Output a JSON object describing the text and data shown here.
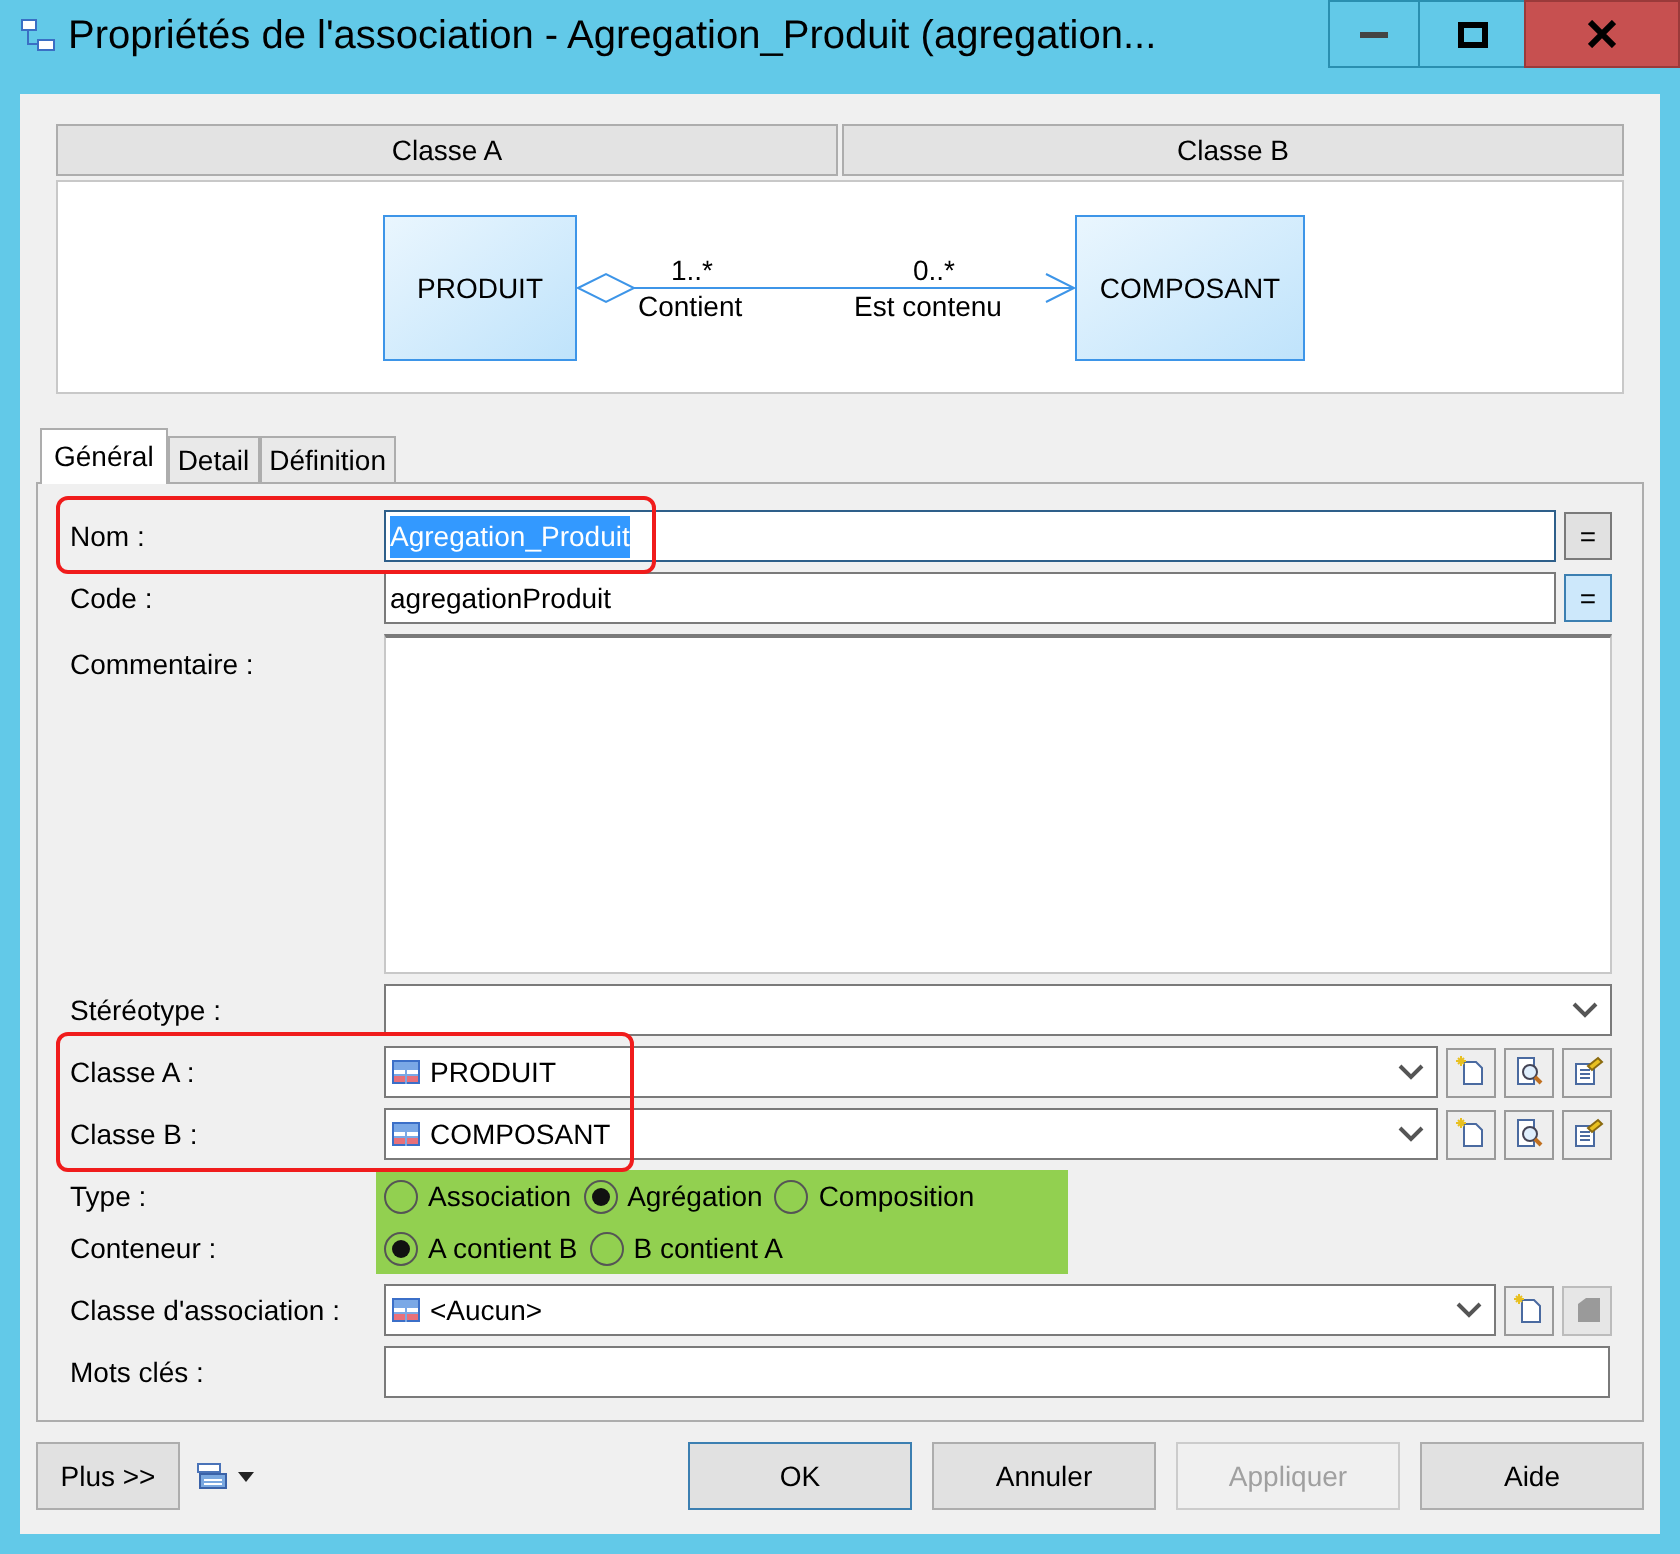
{
  "window": {
    "title": "Propriétés de l'association - Agregation_Produit (agregation..."
  },
  "diagram": {
    "headers": [
      "Classe A",
      "Classe B"
    ],
    "class_a": "PRODUIT",
    "class_b": "COMPOSANT",
    "role_a": {
      "multiplicity": "1..*",
      "name": "Contient"
    },
    "role_b": {
      "multiplicity": "0..*",
      "name": "Est contenu"
    }
  },
  "tabs": [
    {
      "label": "Général",
      "selected": true
    },
    {
      "label": "Detail",
      "selected": false
    },
    {
      "label": "Définition",
      "selected": false
    }
  ],
  "fields": [
    {
      "kind": "text",
      "label": "Nom :",
      "value": "Agregation_Produit",
      "text_selected": true,
      "red_frame": true,
      "equals": {
        "label": "=",
        "on": false
      }
    },
    {
      "kind": "text",
      "label": "Code :",
      "value": "agregationProduit",
      "text_selected": false,
      "equals": {
        "label": "=",
        "on": true
      }
    },
    {
      "kind": "textarea",
      "label": "Commentaire :"
    },
    {
      "kind": "combo",
      "label": "Stéréotype :"
    },
    {
      "kind": "class-combo",
      "label": "Classe A :",
      "value": "PRODUIT",
      "red_frame": true,
      "buttons": [
        {
          "kind": "new",
          "disabled": false
        },
        {
          "kind": "find",
          "disabled": false
        },
        {
          "kind": "properties",
          "disabled": false
        }
      ]
    },
    {
      "kind": "class-combo",
      "label": "Classe B :",
      "value": "COMPOSANT",
      "red_frame": true,
      "buttons": [
        {
          "kind": "new",
          "disabled": false
        },
        {
          "kind": "find",
          "disabled": false
        },
        {
          "kind": "properties",
          "disabled": false
        }
      ]
    },
    {
      "kind": "radio",
      "label": "Type :",
      "green_fill": true,
      "options": [
        {
          "label": "Association",
          "selected": false
        },
        {
          "label": "Agrégation",
          "selected": true
        },
        {
          "label": "Composition",
          "selected": false
        }
      ]
    },
    {
      "kind": "radio",
      "label": "Conteneur :",
      "green_fill": true,
      "options": [
        {
          "label": "A contient B",
          "selected": true
        },
        {
          "label": "B contient A",
          "selected": false
        }
      ]
    },
    {
      "kind": "class-combo",
      "label": "Classe d'association :",
      "value": "<Aucun>",
      "buttons": [
        {
          "kind": "new",
          "disabled": false
        },
        {
          "kind": "properties",
          "disabled": true
        }
      ]
    },
    {
      "kind": "text",
      "label": "Mots clés :"
    }
  ],
  "footer": {
    "more": "Plus >>",
    "actions": [
      {
        "label": "OK",
        "default": true,
        "disabled": false
      },
      {
        "label": "Annuler",
        "default": false,
        "disabled": false
      },
      {
        "label": "Appliquer",
        "default": false,
        "disabled": true
      },
      {
        "label": "Aide",
        "default": false,
        "disabled": false
      }
    ]
  }
}
